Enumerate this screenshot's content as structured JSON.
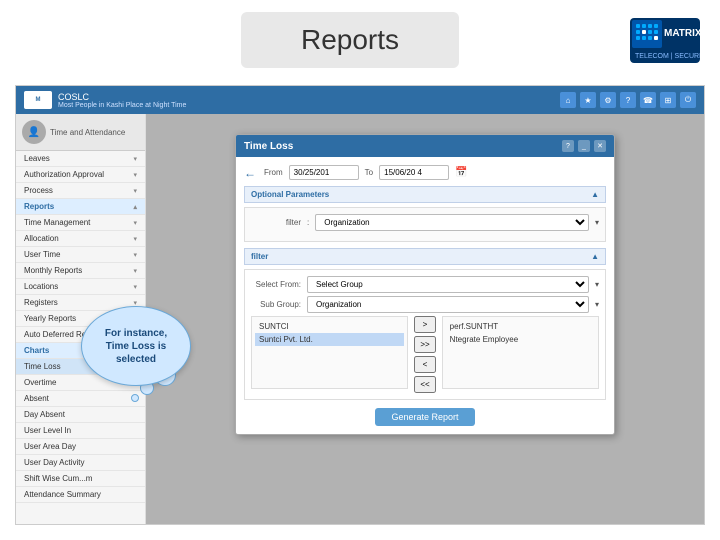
{
  "page": {
    "title": "Reports"
  },
  "logo": {
    "brand": "MATRIX",
    "tagline": "TELECOM | SECURITY"
  },
  "inner_ui": {
    "app_name": "COSLC",
    "app_subtitle": "Most People in Kashi Place at Night Time",
    "nav_icons": [
      "home",
      "star",
      "gear",
      "question",
      "phone",
      "grid",
      "power"
    ]
  },
  "sidebar": {
    "user_label": "Time and Attendance",
    "items": [
      {
        "label": "Leaves",
        "type": "item"
      },
      {
        "label": "Authorization Approval",
        "type": "item"
      },
      {
        "label": "Process",
        "type": "item"
      },
      {
        "label": "Reports",
        "type": "section"
      },
      {
        "label": "Time Management",
        "type": "item"
      },
      {
        "label": "Allocation",
        "type": "item"
      },
      {
        "label": "User Time",
        "type": "item"
      },
      {
        "label": "Monthly Reports",
        "type": "item"
      },
      {
        "label": "Locations",
        "type": "item"
      },
      {
        "label": "Registers",
        "type": "item"
      },
      {
        "label": "Yearly Reports",
        "type": "item"
      },
      {
        "label": "Auto Deferred Records",
        "type": "item"
      },
      {
        "label": "Charts",
        "type": "section"
      },
      {
        "label": "Time Loss",
        "type": "item",
        "active": true
      },
      {
        "label": "Overtime",
        "type": "item"
      },
      {
        "label": "Absent",
        "type": "item"
      },
      {
        "label": "Day Absent",
        "type": "item"
      },
      {
        "label": "User Level In",
        "type": "item"
      },
      {
        "label": "User Area Day",
        "type": "item"
      },
      {
        "label": "User Day Activity",
        "type": "item"
      },
      {
        "label": "Shift Wise Cum...m",
        "type": "item"
      },
      {
        "label": "Attendance Summary",
        "type": "item"
      }
    ]
  },
  "modal": {
    "title": "Time Loss",
    "date_from_label": "From",
    "date_to_label": "To",
    "date_from": "30/25/201",
    "date_to": "15/06/20 4",
    "optional_params_label": "Optional Parameters",
    "filter_label": "filter",
    "organization_placeholder": "Organization",
    "select_from_label": "Select From:",
    "select_group_label": "Select Group",
    "select_group_placeholder": "Select Group",
    "sub_group_label": "Sub Group:",
    "sub_group_placeholder": "Organization",
    "list_items": [
      {
        "label": "SUNTCI",
        "selected": false
      },
      {
        "label": "Suntci Pvt. Ltd.",
        "selected": false
      }
    ],
    "sub_list_label": "perf.SUNTHT",
    "sub_list_sub": "Ntegrate Employee",
    "generate_btn": "Generate Report"
  },
  "callout": {
    "text": "For instance,\nTime Loss is\nselected"
  }
}
